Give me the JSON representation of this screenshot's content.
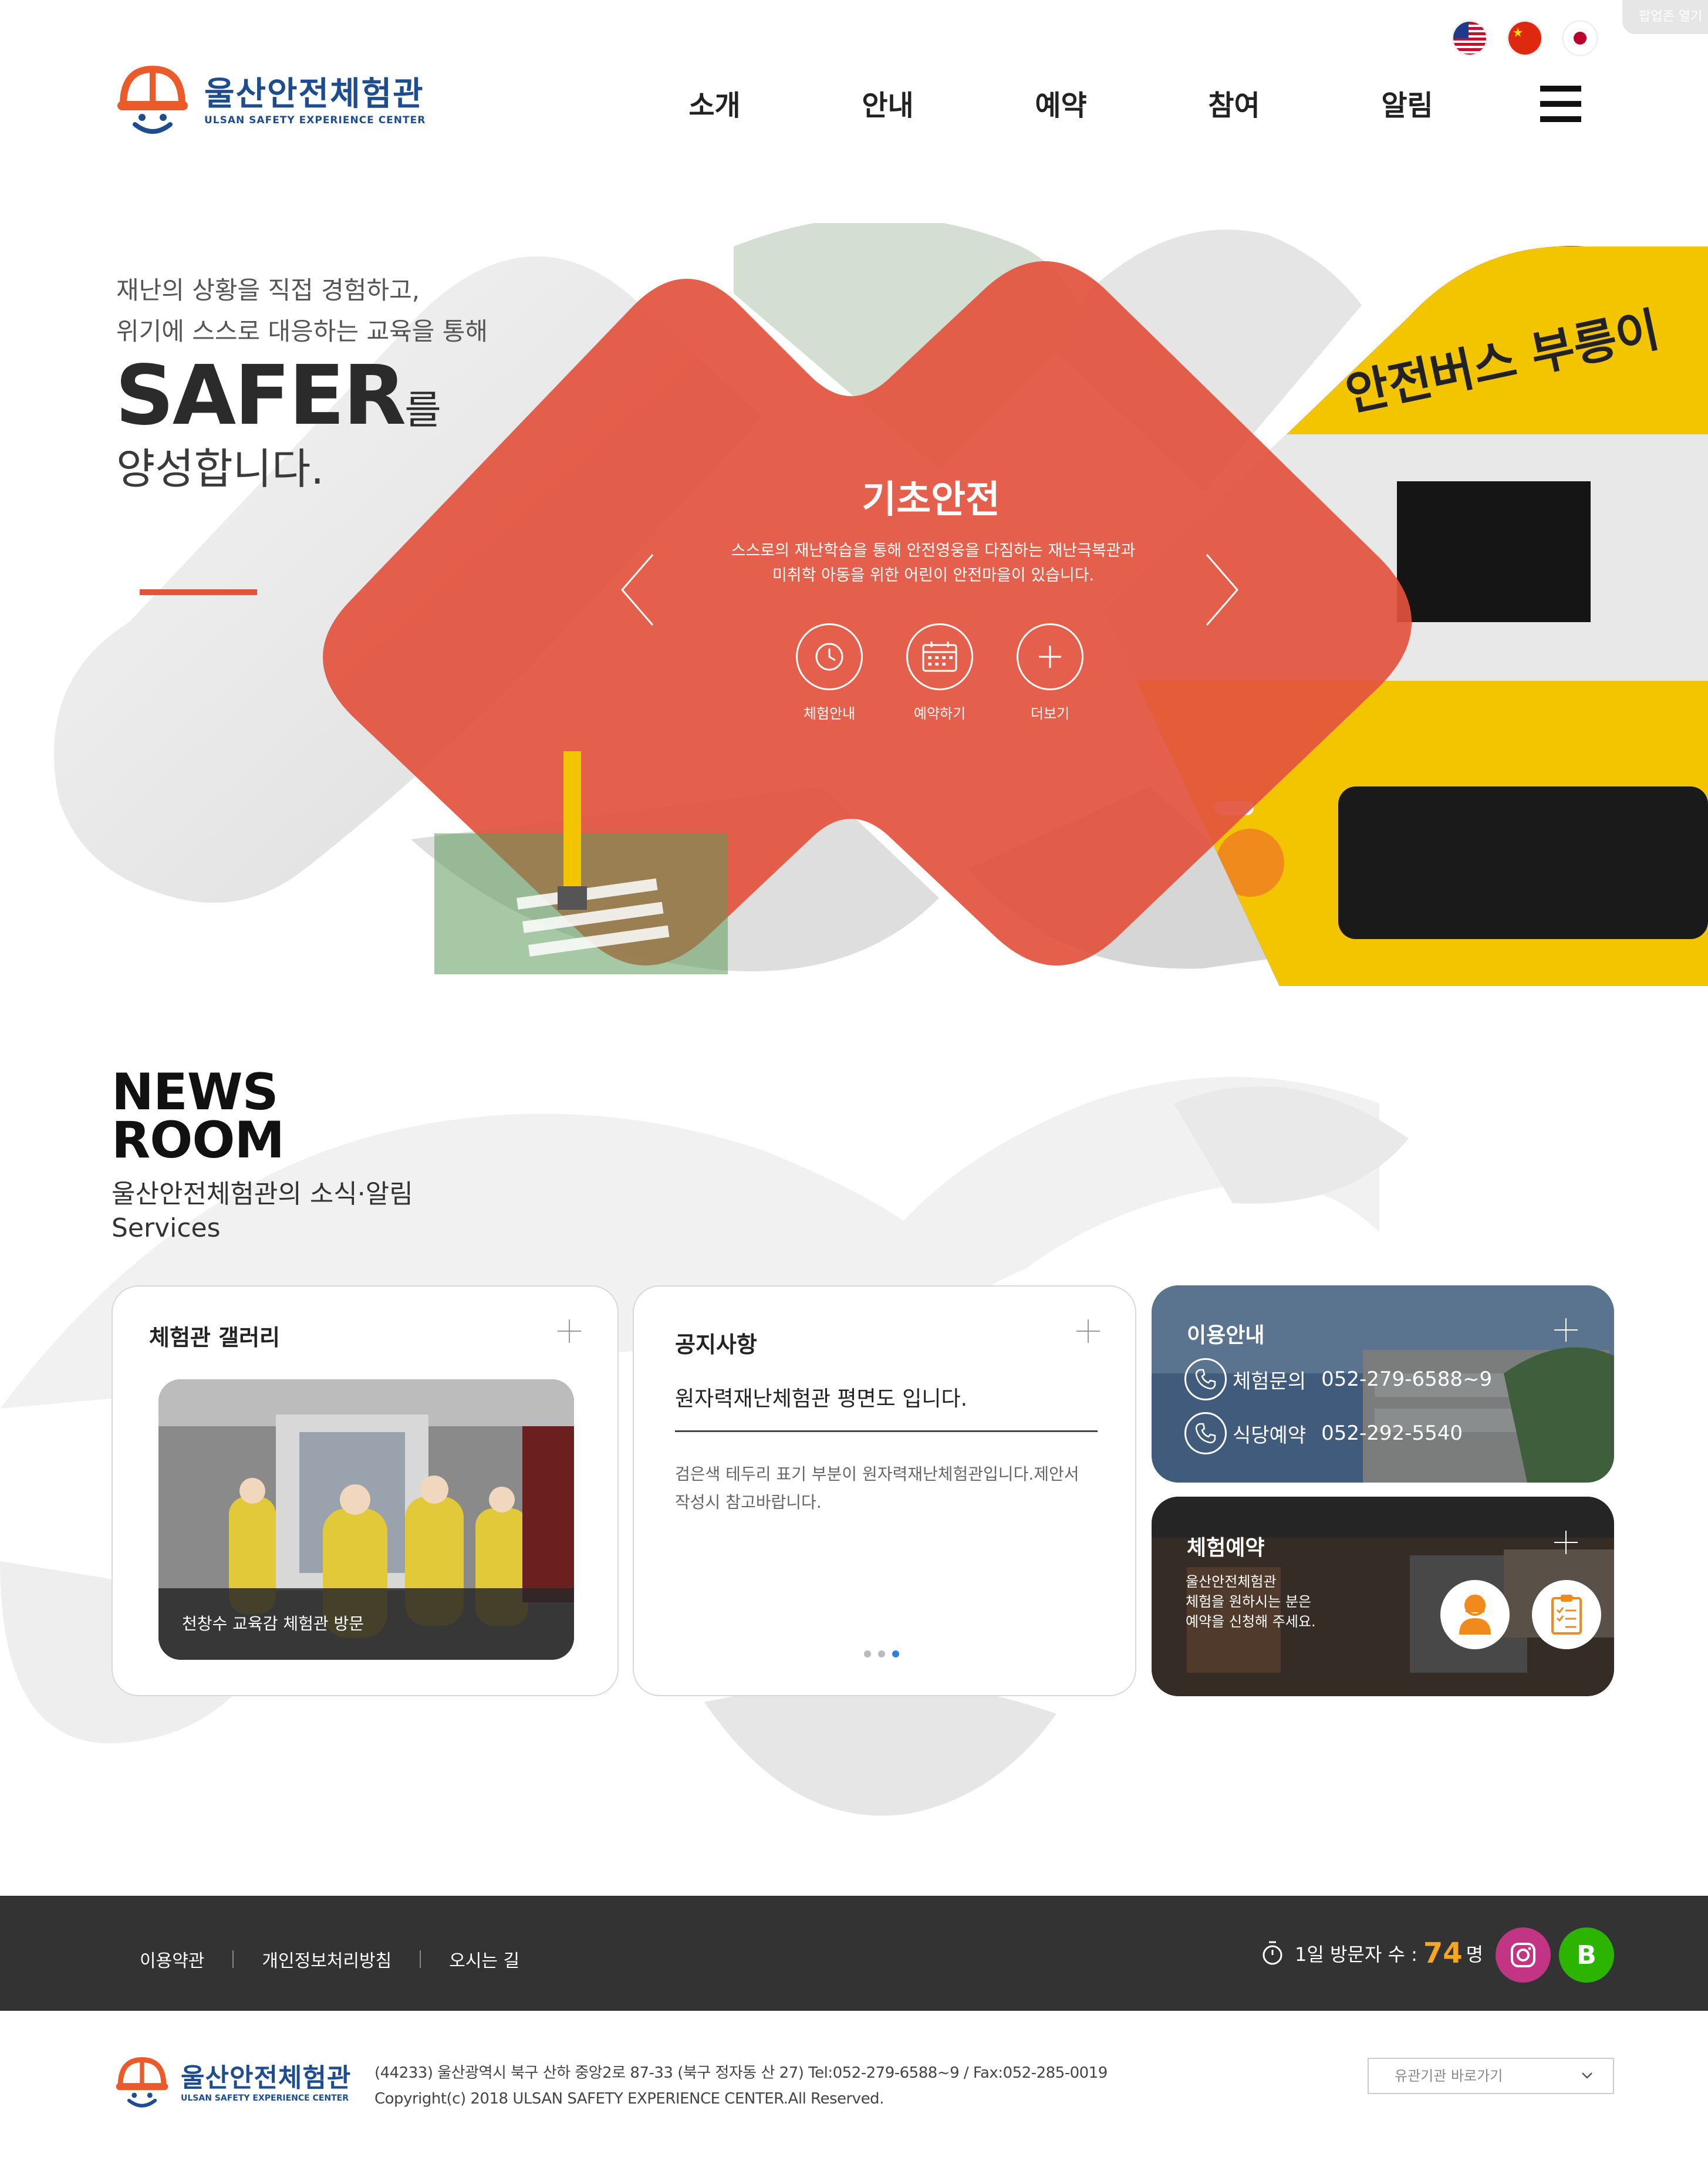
{
  "popup_tab": "팝업존 열기",
  "languages": [
    {
      "name": "us-flag-icon",
      "label": "English"
    },
    {
      "name": "china-flag-icon",
      "label": "Chinese"
    },
    {
      "name": "japan-flag-icon",
      "label": "Japanese"
    }
  ],
  "header": {
    "logo_title": "울산안전체험관",
    "logo_subtitle": "ULSAN SAFETY EXPERIENCE CENTER",
    "nav": [
      "소개",
      "안내",
      "예약",
      "참여",
      "알림"
    ]
  },
  "hero": {
    "copy_line1": "재난의 상황을 직접 경험하고,",
    "copy_line2": "위기에 스스로 대응하는 교육을 통해",
    "big_word": "SAFER",
    "big_particle": "를",
    "big_line2": "양성합니다.",
    "slide": {
      "title": "기초안전",
      "desc_line1": "스스로의 재난학습을 통해 안전영웅을 다짐하는 재난극복관과",
      "desc_line2": "미취학 아동을 위한 어린이 안전마을이 있습니다.",
      "buttons": [
        {
          "label": "체험안내",
          "icon": "clock-icon"
        },
        {
          "label": "예약하기",
          "icon": "calendar-icon"
        },
        {
          "label": "더보기",
          "icon": "plus-icon"
        }
      ]
    },
    "colors": {
      "accent": "#e3533d",
      "bus_yellow": "#f2c500"
    }
  },
  "news": {
    "title_line1": "NEWS",
    "title_line2": "ROOM",
    "sub_line1": "울산안전체험관의 소식·알림",
    "sub_line2": "Services"
  },
  "gallery": {
    "title": "체험관 갤러리",
    "caption": "천창수 교육감 체험관 방문"
  },
  "notice": {
    "title": "공지사항",
    "headline": "원자력재난체험관 평면도 입니다.",
    "body": "검은색 테두리 표기 부분이 원자력재난체험관입니다.제안서 작성시 참고바랍니다.",
    "page_count": 3,
    "active_page": 3
  },
  "info": {
    "title": "이용안내",
    "rows": [
      {
        "label": "체험문의",
        "number": "052-279-6588~9"
      },
      {
        "label": "식당예약",
        "number": "052-292-5540"
      }
    ]
  },
  "reservation": {
    "title": "체험예약",
    "desc_line1": "울산안전체험관",
    "desc_line2": "체험을 원하시는 분은",
    "desc_line3": "예약을 신청해 주세요."
  },
  "footer": {
    "links": [
      "이용약관",
      "개인정보처리방침",
      "오시는 길"
    ],
    "visitors_label": "1일 방문자 수 :",
    "visitors_count": "74",
    "visitors_unit": "명",
    "blog_letter": "B",
    "logo_title": "울산안전체험관",
    "logo_subtitle": "ULSAN SAFETY EXPERIENCE CENTER",
    "address": "(44233) 울산광역시 북구 산하 중앙2로 87-33 (북구 정자동 산 27) Tel:052-279-6588~9 / Fax:052-285-0019",
    "copyright": "Copyright(c) 2018 ULSAN SAFETY EXPERIENCE CENTER.All Reserved.",
    "related_select": "유관기관 바로가기"
  }
}
